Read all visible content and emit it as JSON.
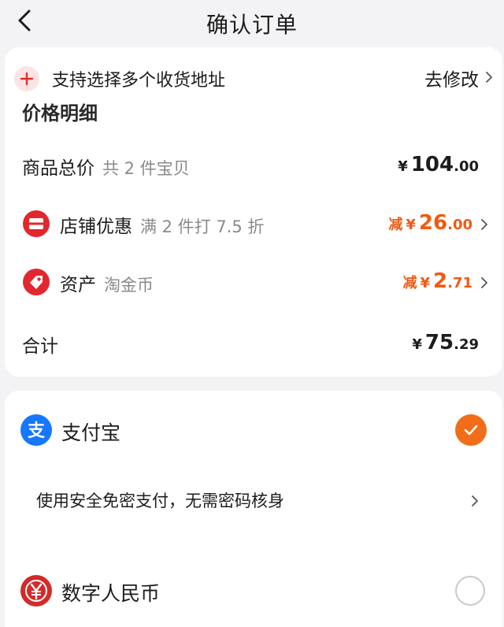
{
  "header": {
    "title": "确认订单",
    "back_icon": "chevron-left-icon"
  },
  "address": {
    "label": "支持选择多个收货地址",
    "action": "去修改"
  },
  "price_section": {
    "title_partial": "价格明细",
    "rows": [
      {
        "label": "商品总价",
        "sub": "共 2 件宝贝",
        "prefix": "",
        "yen": "¥",
        "int": "104",
        "dec": ".00",
        "icon": ""
      },
      {
        "label": "店铺优惠",
        "sub": "满 2 件打 7.5 折",
        "prefix": "减",
        "yen": "¥",
        "int": "26",
        "dec": ".00",
        "icon": "shop-discount-icon"
      },
      {
        "label": "资产",
        "sub": "淘金币",
        "prefix": "减",
        "yen": "¥",
        "int": "2",
        "dec": ".71",
        "icon": "coin-tag-icon"
      },
      {
        "label": "合计",
        "sub": "",
        "prefix": "",
        "yen": "¥",
        "int": "75",
        "dec": ".29",
        "icon": ""
      }
    ]
  },
  "payment": {
    "methods": [
      {
        "label": "支付宝",
        "icon": "alipay-icon",
        "selected": true,
        "sub": "使用安全免密支付，无需密码核身"
      },
      {
        "label": "数字人民币",
        "icon": "ecny-icon",
        "selected": false
      }
    ]
  },
  "colors": {
    "accent": "#f26d1a",
    "discount": "#f05a12",
    "alipay": "#1677ff",
    "ecny": "#d42a2a",
    "background": "#f3f3f6"
  }
}
